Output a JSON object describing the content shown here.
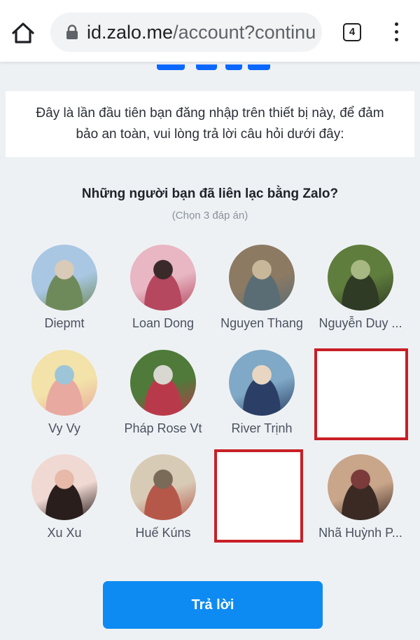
{
  "browser": {
    "url_host": "id.zalo.me",
    "url_path": "/account?continu",
    "tab_count": "4"
  },
  "notice": {
    "line1": "Đây là lần đầu tiên bạn đăng nhập trên thiết bị này, để đảm",
    "line2": "bảo an toàn, vui lòng trả lời câu hỏi dưới đây:"
  },
  "question": {
    "title": "Những người bạn đã liên lạc bằng Zalo?",
    "hint": "(Chọn 3 đáp án)"
  },
  "friends": [
    {
      "name": "Diepmt",
      "palette": [
        "#a9c7e3",
        "#6f8a5a",
        "#d9cbb8"
      ]
    },
    {
      "name": "Loan Dong",
      "palette": [
        "#e8b7c3",
        "#b5475f",
        "#3a2a2a"
      ]
    },
    {
      "name": "Nguyen Thang",
      "palette": [
        "#8d7a63",
        "#5a6d74",
        "#c9b79a"
      ]
    },
    {
      "name": "Nguyễn Duy ...",
      "palette": [
        "#5f7d3c",
        "#2f3b25",
        "#a7b883"
      ]
    },
    {
      "name": "Vy Vy",
      "palette": [
        "#f3e2a9",
        "#e8a9a0",
        "#9cc6d8"
      ]
    },
    {
      "name": "Pháp Rose Vt",
      "palette": [
        "#4f7a3a",
        "#b83a4a",
        "#d8d8d0"
      ]
    },
    {
      "name": "River Trịnh",
      "palette": [
        "#7fa9c6",
        "#2b3f66",
        "#e9d6c2"
      ]
    },
    {
      "name": "Xu Xu",
      "palette": [
        "#f0d9d3",
        "#2a1e1c",
        "#e7b9a8"
      ]
    },
    {
      "name": "Huế Kúns",
      "palette": [
        "#d8cbb6",
        "#b5584a",
        "#7a6a58"
      ]
    },
    {
      "name": "Nhã Huỳnh P...",
      "palette": [
        "#c9a58a",
        "#3b2a24",
        "#7a3b3a"
      ]
    }
  ],
  "submit_label": "Trả lời",
  "colors": {
    "accent": "#0d8bf2",
    "redaction_border": "#c81f26"
  }
}
